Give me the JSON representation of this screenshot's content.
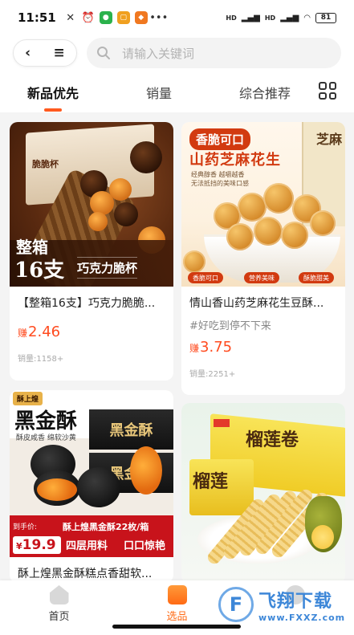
{
  "status_bar": {
    "time": "11:51",
    "battery": "81",
    "signal1": "HD",
    "signal2": "HD"
  },
  "top_bar": {
    "back_icon": "chevron-left-icon",
    "menu_icon": "menu-icon",
    "search_placeholder": "请输入关键词"
  },
  "tabs": [
    {
      "label": "新品优先",
      "active": true
    },
    {
      "label": "销量",
      "active": false
    },
    {
      "label": "综合推荐",
      "active": false
    }
  ],
  "products": [
    {
      "title": "【整箱16支】巧克力脆脆...",
      "tagline": "",
      "price_prefix": "赚",
      "price": "2.46",
      "sales": "销量:1158+",
      "img_text": {
        "line1": "整箱",
        "line2": "16支",
        "line3": "巧克力脆杯",
        "box": "脆脆杯"
      }
    },
    {
      "title": "情山香山药芝麻花生豆酥...",
      "tagline": "#好吃到停不下来",
      "price_prefix": "赚",
      "price": "3.75",
      "sales": "销量:2251+",
      "img_text": {
        "chip": "香脆可口",
        "sub": "山药芝麻花生",
        "small1": "经典醇香 越嚼越香",
        "small2": "无法抵挡的美味口感",
        "bag": "芝麻",
        "p1": "香脆可口",
        "p2": "营养美味",
        "p3": "酥脆甜美"
      }
    },
    {
      "title": "酥上煌黑金酥糕点香甜软...",
      "img_text": {
        "brand": "酥上煌",
        "big": "黑金酥",
        "sm": "酥皮咸香 绵软沙黄",
        "box": "黑金酥",
        "pl": "到手价:",
        "price": "19.9",
        "l1": "酥上煌黑金酥22枚/箱",
        "l2": "四层用料",
        "l3": "口口惊艳"
      }
    },
    {
      "title": "",
      "img_text": {
        "bt": "榴莲卷",
        "bt2": "榴莲"
      }
    }
  ],
  "bottom_nav": [
    {
      "label": "首页",
      "icon": "home-icon"
    },
    {
      "label": "选品",
      "icon": "select-icon",
      "active": true
    },
    {
      "label": "",
      "icon": "profile-icon"
    }
  ],
  "watermark": {
    "cn": "飞翔下载",
    "en": "www.FXXZ.com"
  }
}
